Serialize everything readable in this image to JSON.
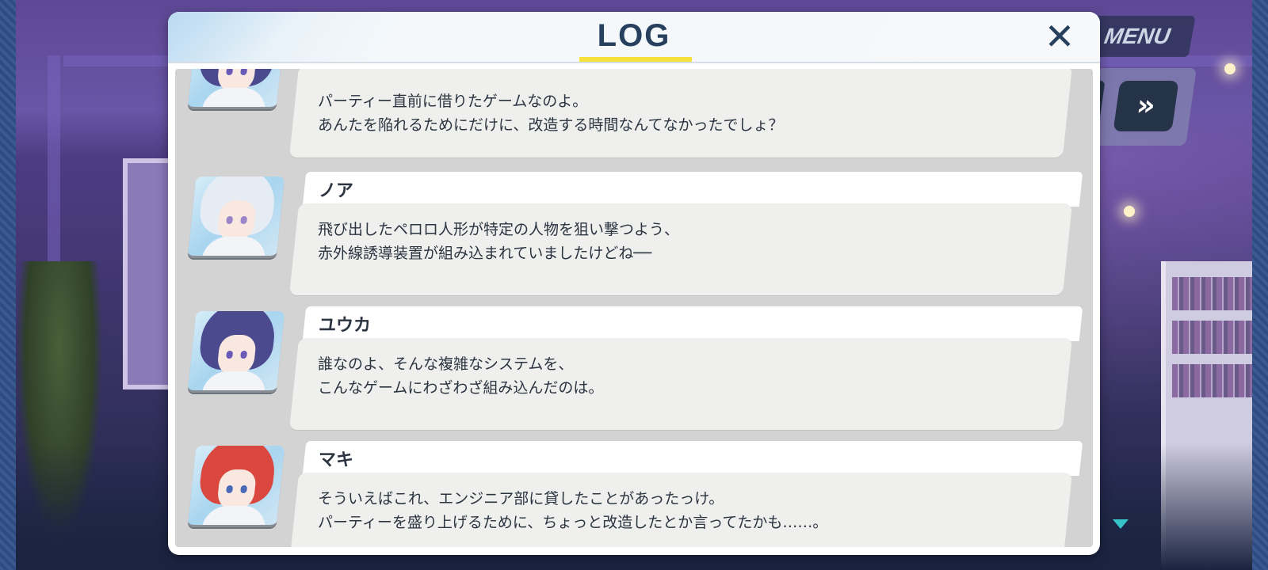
{
  "hud": {
    "menu_label": "MENU",
    "skip_label": "»"
  },
  "log": {
    "title": "LOG",
    "close_label": "✕",
    "entries": [
      {
        "speaker": "",
        "lines": [
          "パーティー直前に借りたゲームなのよ。",
          "あんたを陥れるためにだけに、改造する時間なんてなかったでしょ？"
        ],
        "portrait": "yuuka"
      },
      {
        "speaker": "ノア",
        "lines": [
          "飛び出したペロロ人形が特定の人物を狙い撃つよう、",
          "赤外線誘導装置が組み込まれていましたけどね──"
        ],
        "portrait": "noa"
      },
      {
        "speaker": "ユウカ",
        "lines": [
          "誰なのよ、そんな複雑なシステムを、",
          "こんなゲームにわざわざ組み込んだのは。"
        ],
        "portrait": "yuuka"
      },
      {
        "speaker": "マキ",
        "lines": [
          "そういえばこれ、エンジニア部に貸したことがあったっけ。",
          "パーティーを盛り上げるために、ちょっと改造したとか言ってたかも……。"
        ],
        "portrait": "maki"
      }
    ]
  },
  "colors": {
    "title": "#26405e",
    "underline": "#f5e13a",
    "yuuka_hair": "#4b4a8e",
    "noa_hair": "#e6ecf4",
    "maki_hair": "#d9473e"
  }
}
